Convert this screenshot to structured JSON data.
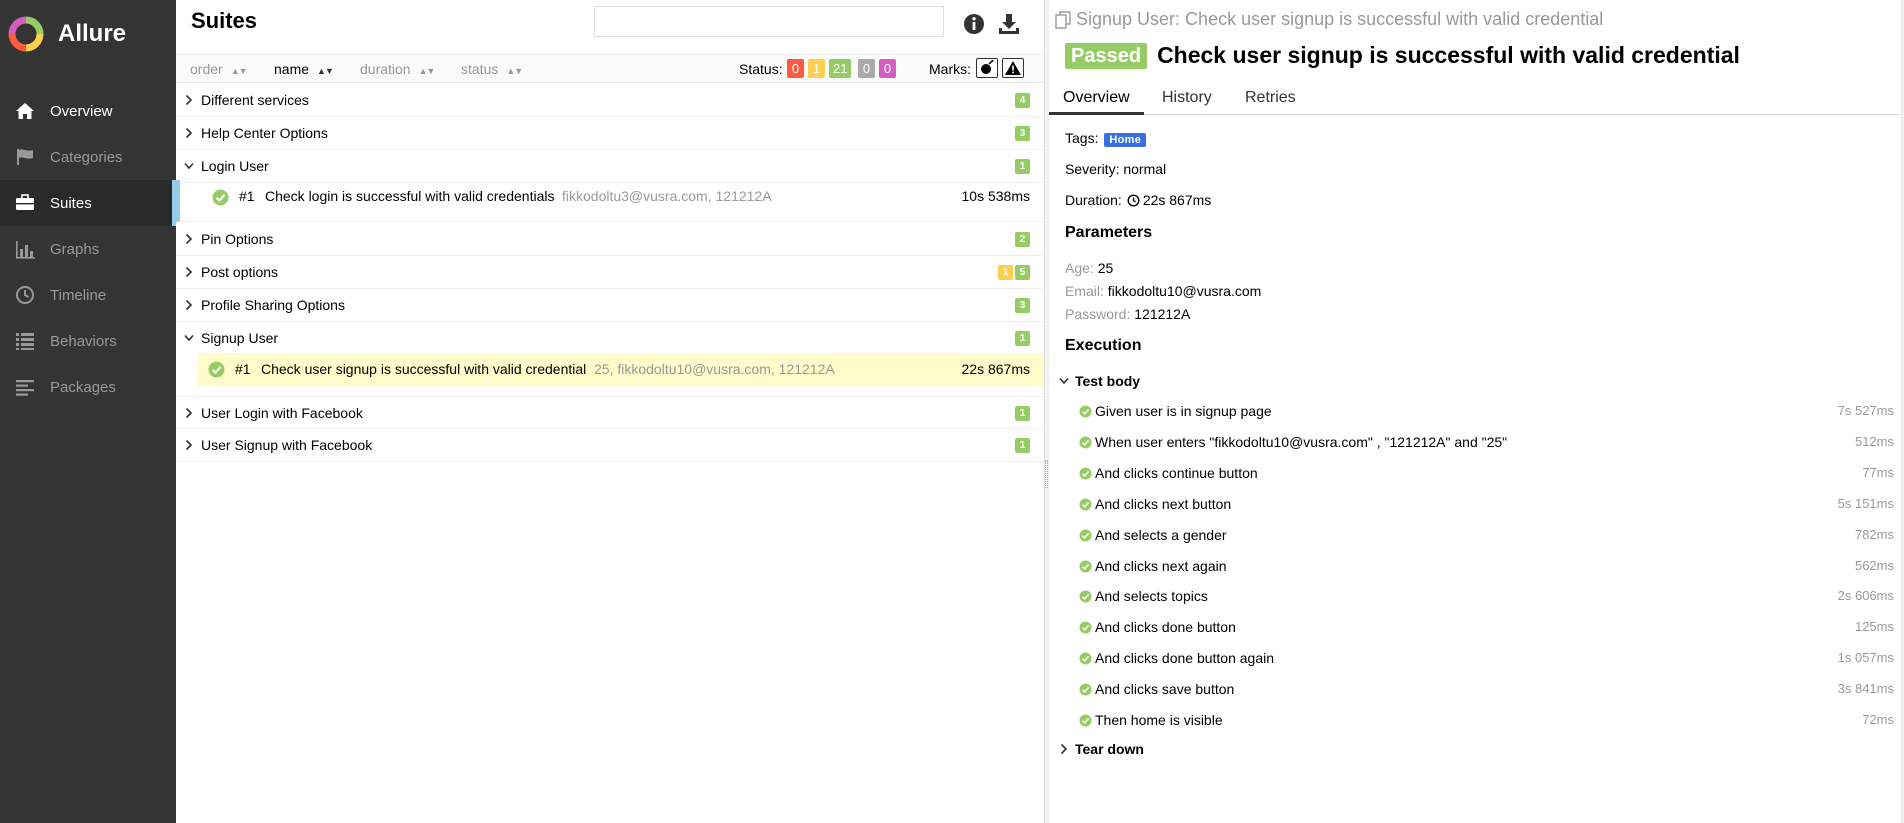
{
  "app": {
    "name": "Allure"
  },
  "sidebar": {
    "items": [
      {
        "label": "Overview",
        "icon": "home-icon"
      },
      {
        "label": "Categories",
        "icon": "flag-icon"
      },
      {
        "label": "Suites",
        "icon": "briefcase-icon"
      },
      {
        "label": "Graphs",
        "icon": "bar-chart-icon"
      },
      {
        "label": "Timeline",
        "icon": "clock-icon"
      },
      {
        "label": "Behaviors",
        "icon": "list-icon"
      },
      {
        "label": "Packages",
        "icon": "align-left-icon"
      }
    ]
  },
  "suites": {
    "title": "Suites",
    "search_value": "",
    "sort": {
      "order": "order",
      "name": "name",
      "duration": "duration",
      "status": "status"
    },
    "status_label": "Status:",
    "status_counts": {
      "failed": "0",
      "broken": "1",
      "passed": "21",
      "skipped": "0",
      "unknown": "0"
    },
    "marks_label": "Marks:",
    "groups": [
      {
        "label": "Different services",
        "counts": [
          "4"
        ]
      },
      {
        "label": "Help Center Options",
        "counts": [
          "3"
        ]
      },
      {
        "label": "Login User",
        "counts": [
          "1"
        ]
      },
      {
        "label": "Pin Options",
        "counts": [
          "2"
        ]
      },
      {
        "label": "Post options",
        "counts": [
          "1",
          "5"
        ]
      },
      {
        "label": "Profile Sharing Options",
        "counts": [
          "3"
        ]
      },
      {
        "label": "Signup User",
        "counts": [
          "1"
        ]
      },
      {
        "label": "User Login with Facebook",
        "counts": [
          "1"
        ]
      },
      {
        "label": "User Signup with Facebook",
        "counts": [
          "1"
        ]
      }
    ],
    "login_test": {
      "num": "#1",
      "name": "Check login is successful with valid credentials",
      "params": "fikkodoltu3@vusra.com, 121212A",
      "duration": "10s 538ms"
    },
    "signup_test": {
      "num": "#1",
      "name": "Check user signup is successful with valid credential",
      "params": "25, fikkodoltu10@vusra.com, 121212A",
      "duration": "22s 867ms"
    }
  },
  "detail": {
    "crumb": "Signup User: Check user signup is successful with valid credential",
    "status": "Passed",
    "title": "Check user signup is successful with valid credential",
    "tabs": [
      "Overview",
      "History",
      "Retries"
    ],
    "tags_label": "Tags:",
    "tag": "Home",
    "severity_label": "Severity:",
    "severity": "normal",
    "duration_label": "Duration:",
    "duration": "22s 867ms",
    "parameters_title": "Parameters",
    "parameters": [
      {
        "key": "Age",
        "value": "25"
      },
      {
        "key": "Email",
        "value": "fikkodoltu10@vusra.com"
      },
      {
        "key": "Password",
        "value": "121212A"
      }
    ],
    "execution_title": "Execution",
    "test_body_label": "Test body",
    "steps": [
      {
        "text": "Given user is in signup page",
        "duration": "7s 527ms"
      },
      {
        "text": "When user enters \"fikkodoltu10@vusra.com\" , \"121212A\" and \"25\"",
        "duration": "512ms"
      },
      {
        "text": "And clicks continue button",
        "duration": "77ms"
      },
      {
        "text": "And clicks next button",
        "duration": "5s 151ms"
      },
      {
        "text": "And selects a gender",
        "duration": "782ms"
      },
      {
        "text": "And clicks next again",
        "duration": "562ms"
      },
      {
        "text": "And selects topics",
        "duration": "2s 606ms"
      },
      {
        "text": "And clicks done button",
        "duration": "125ms"
      },
      {
        "text": "And clicks done button again",
        "duration": "1s 057ms"
      },
      {
        "text": "And clicks save button",
        "duration": "3s 841ms"
      },
      {
        "text": "Then home is visible",
        "duration": "72ms"
      }
    ],
    "tear_down_label": "Tear down"
  },
  "colors": {
    "passed": "#97cc64",
    "failed": "#fd5a3e",
    "broken": "#ffd050",
    "skipped": "#aaaaaa",
    "unknown": "#d35ebe",
    "sidebar": "#343434",
    "highlight": "#fffbca",
    "tag": "#3a6fe0"
  }
}
